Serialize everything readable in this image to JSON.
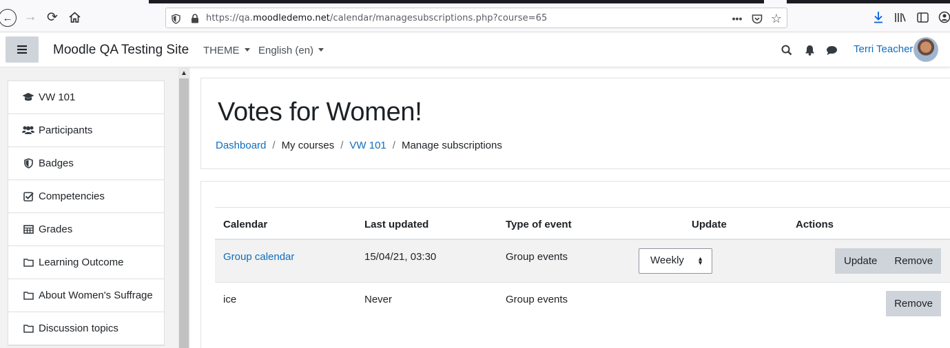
{
  "browser": {
    "url_prefix": "https://qa.",
    "url_domain": "moodledemo.net",
    "url_path": "/calendar/managesubscriptions.php?course=65"
  },
  "navbar": {
    "site_name": "Moodle QA Testing Site",
    "theme_label": "THEME",
    "language_label": "English (en)",
    "user_name": "Terri Teacher"
  },
  "drawer": {
    "items": [
      {
        "label": "VW 101",
        "icon": "graduation-cap-icon"
      },
      {
        "label": "Participants",
        "icon": "users-icon"
      },
      {
        "label": "Badges",
        "icon": "shield-icon"
      },
      {
        "label": "Competencies",
        "icon": "checkbox-icon"
      },
      {
        "label": "Grades",
        "icon": "table-icon"
      },
      {
        "label": "Learning Outcome",
        "icon": "folder-icon"
      },
      {
        "label": "About Women's Suffrage",
        "icon": "folder-icon"
      },
      {
        "label": "Discussion topics",
        "icon": "folder-icon"
      }
    ]
  },
  "header": {
    "title": "Votes for Women!",
    "breadcrumb": [
      "Dashboard",
      "My courses",
      "VW 101",
      "Manage subscriptions"
    ]
  },
  "table": {
    "headers": [
      "Calendar",
      "Last updated",
      "Type of event",
      "Update",
      "Actions"
    ],
    "rows": [
      {
        "calendar": "Group calendar",
        "last_updated": "15/04/21, 03:30",
        "type": "Group events",
        "update": "Weekly",
        "update_btn": "Update",
        "remove_btn": "Remove"
      },
      {
        "calendar": "ice",
        "last_updated": "Never",
        "type": "Group events",
        "remove_btn": "Remove"
      }
    ]
  }
}
